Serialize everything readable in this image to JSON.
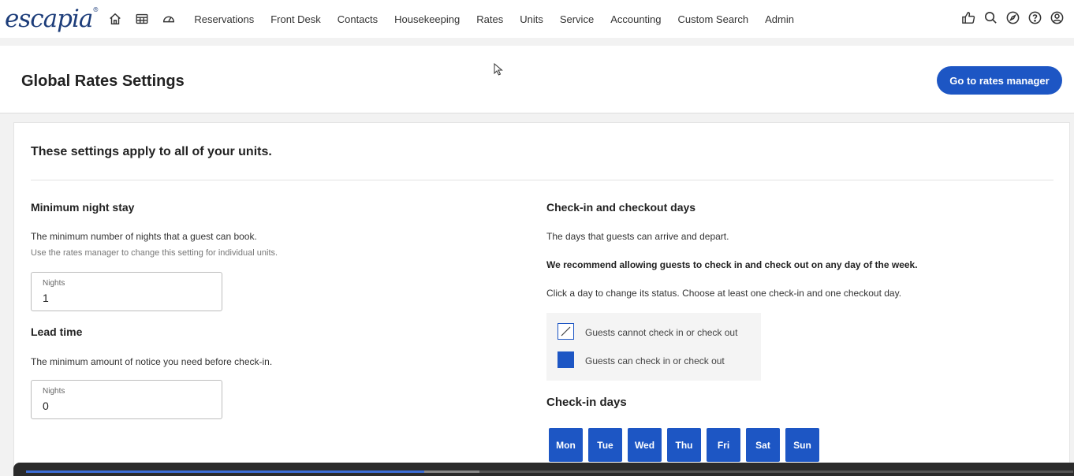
{
  "brand": {
    "logo": "escapia",
    "mark": "®"
  },
  "nav": {
    "icons": [
      "home-icon",
      "calendar-grid-icon",
      "dashboard-gauge-icon"
    ],
    "items": [
      "Reservations",
      "Front Desk",
      "Contacts",
      "Housekeeping",
      "Rates",
      "Units",
      "Service",
      "Accounting",
      "Custom Search",
      "Admin"
    ],
    "right_icons": [
      "thumbs-up-icon",
      "search-icon",
      "compass-icon",
      "help-icon",
      "user-icon"
    ]
  },
  "header": {
    "title": "Global Rates Settings",
    "button": "Go to rates manager"
  },
  "main": {
    "intro": "These settings apply to all of your units.",
    "min_stay": {
      "title": "Minimum night stay",
      "desc": "The minimum number of nights that a guest can book.",
      "note": "Use the rates manager to change this setting for individual units.",
      "field_label": "Nights",
      "value": "1"
    },
    "lead_time": {
      "title": "Lead time",
      "desc": "The minimum amount of notice you need before check-in.",
      "field_label": "Nights",
      "value": "0"
    },
    "checkin_checkout": {
      "title": "Check-in and checkout days",
      "desc": "The days that guests can arrive and depart.",
      "recommend": "We recommend allowing guests to check in and check out on any day of the week.",
      "instruction": "Click a day to change its status. Choose at least one check-in and one checkout day.",
      "legend_off": "Guests cannot check in or check out",
      "legend_on": "Guests can check in or check out",
      "checkin_title": "Check-in days",
      "days": [
        "Mon",
        "Tue",
        "Wed",
        "Thu",
        "Fri",
        "Sat",
        "Sun"
      ]
    }
  },
  "colors": {
    "accent": "#1d56c4",
    "logo": "#1d3d7a",
    "player_progress": "#3d6fd8"
  },
  "player": {
    "played": 0.38,
    "buffered": 0.433
  }
}
